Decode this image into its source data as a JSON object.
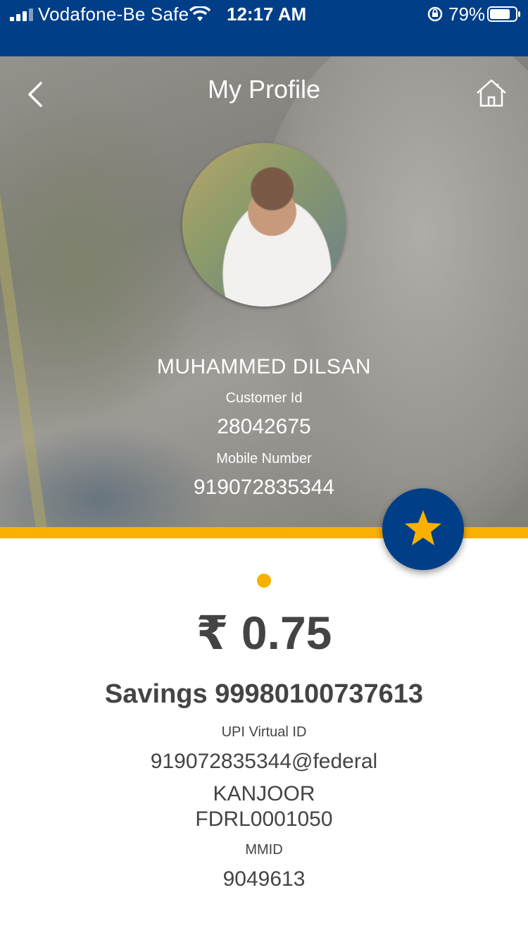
{
  "status_bar": {
    "carrier": "Vodafone-Be Safe",
    "time": "12:17 AM",
    "battery": "79%",
    "icons": [
      "signal-icon",
      "wifi-icon",
      "orientation-lock-icon",
      "battery-icon"
    ]
  },
  "header": {
    "title": "My Profile",
    "back_icon": "chevron-left-icon",
    "home_icon": "home-icon"
  },
  "profile": {
    "name": "MUHAMMED DILSAN",
    "customer_id_label": "Customer Id",
    "customer_id": "28042675",
    "mobile_label": "Mobile Number",
    "mobile": "919072835344"
  },
  "account": {
    "balance": "₹ 0.75",
    "account_line": "Savings 99980100737613",
    "upi_label": "UPI Virtual ID",
    "upi_id": "919072835344@federal",
    "branch": "KANJOOR",
    "ifsc": "FDRL0001050",
    "mmid_label": "MMID",
    "mmid": "9049613"
  },
  "colors": {
    "brand_blue": "#003f87",
    "accent_yellow": "#f9b100",
    "text_dark": "#444444"
  }
}
